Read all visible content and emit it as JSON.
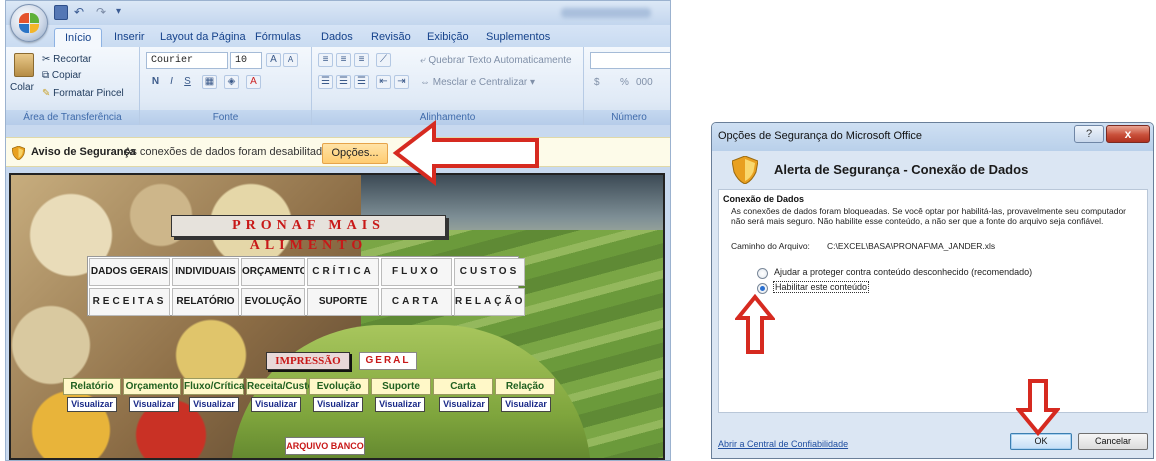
{
  "excel": {
    "tabs": [
      "Início",
      "Inserir",
      "Layout da Página",
      "Fórmulas",
      "Dados",
      "Revisão",
      "Exibição",
      "Suplementos"
    ],
    "ribbon": {
      "clipboard": {
        "paste": "Colar",
        "cut": "Recortar",
        "copy": "Copiar",
        "format_painter": "Formatar Pincel",
        "label": "Área de Transferência"
      },
      "font": {
        "name": "Courier",
        "size": "10",
        "label": "Fonte",
        "bold": "N",
        "italic": "I",
        "underline": "S",
        "grow": "A",
        "shrink": "A"
      },
      "alignment": {
        "wrap": "Quebrar Texto Automaticamente",
        "merge": "Mesclar e Centralizar",
        "label": "Alinhamento"
      },
      "number": {
        "format": "",
        "currency": "$",
        "percent": "%",
        "thousands": "000",
        "label": "Número"
      }
    },
    "security_bar": {
      "title": "Aviso de Segurança",
      "message": "As conexões de dados foram desabilitadas",
      "button": "Opções..."
    },
    "sheet": {
      "title": "PRONAF MAIS ALIMENTO",
      "menu": [
        [
          "DADOS GERAIS",
          "INDIVIDUAIS",
          "ORÇAMENTO",
          "CRÍTICA",
          "FLUXO",
          "CUSTOS"
        ],
        [
          "RECEITAS",
          "RELATÓRIO",
          "EVOLUÇÃO",
          "SUPORTE",
          "CARTA",
          "RELAÇÃO"
        ]
      ],
      "print_label": "IMPRESSÃO",
      "general_label": "GERAL",
      "reports": [
        "Relatório",
        "Orçamento",
        "Fluxo/Crítica",
        "Receita/Custo",
        "Evolução",
        "Suporte",
        "Carta",
        "Relação"
      ],
      "view_label": "Visualizar",
      "bank_file": "ARQUIVO BANCO"
    }
  },
  "dialog": {
    "window_title": "Opções de Segurança do Microsoft Office",
    "help": "?",
    "close": "x",
    "heading": "Alerta de Segurança - Conexão de Dados",
    "section": "Conexão de Dados",
    "description": "As conexões de dados foram bloqueadas. Se você optar por habilitá-las, provavelmente seu computador não será mais seguro. Não habilite esse conteúdo, a não ser que a fonte do arquivo seja confiável.",
    "path_label": "Caminho do Arquivo:",
    "path_value": "C:\\EXCEL\\BASA\\PRONAF\\MA_JANDER.xls",
    "option_protect": "Ajudar a proteger contra conteúdo desconhecido (recomendado)",
    "option_enable": "Habilitar este conteúdo",
    "selected_option": "enable",
    "trust_center_link": "Abrir a Central de Confiabilidade",
    "ok": "OK",
    "cancel": "Cancelar"
  },
  "colors": {
    "arrow": "#d62a20",
    "accent": "#15428b",
    "title_red": "#c81818"
  }
}
